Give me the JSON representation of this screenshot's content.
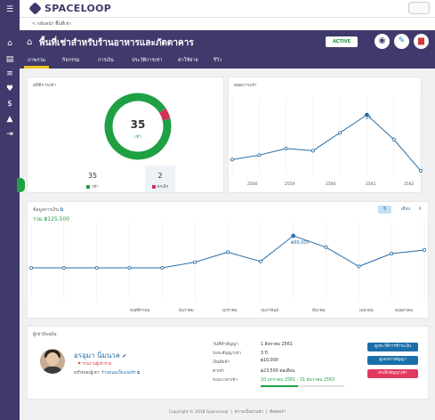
{
  "app": {
    "logo_text": "SPACELOOP"
  },
  "breadcrumb": {
    "back_label": "< กลับหน้า พื้นที่เช่า"
  },
  "header": {
    "title": "พื้นที่เช่าสำหรับร้านอาหารและภัตตาคาร",
    "status": "ACTIVE",
    "icons": {
      "title": "shop-icon",
      "view": "eye-icon",
      "edit": "pencil-icon",
      "delete": "trash-icon"
    },
    "colors": {
      "brand": "#3f3a6b",
      "accent_underline": "#f0c419",
      "edit": "#2a7fd4",
      "delete": "#d23a3a"
    }
  },
  "tabs": [
    {
      "label": "ภาพรวม",
      "active": true
    },
    {
      "label": "กิจกรรม",
      "active": false
    },
    {
      "label": "การเงิน",
      "active": false
    },
    {
      "label": "ประวัติการเช่า",
      "active": false
    },
    {
      "label": "ค่าใช้จ่าย",
      "active": false
    },
    {
      "label": "รีวิว",
      "active": false
    }
  ],
  "rental_stats": {
    "title": "สถิติการเช่า",
    "center_value": "35",
    "center_label": "เช่า",
    "rented": {
      "value": "35",
      "label": "เช่า",
      "color": "#1fa043"
    },
    "cancelled": {
      "value": "2",
      "label": "ยกเลิก",
      "color": "#d2335c"
    }
  },
  "rental_count": {
    "title": "ยอดการเช่า",
    "highlight_label": "27"
  },
  "finance": {
    "title": "ข้อมูลการเงิน",
    "total": "รวม ฿125,500",
    "toggle_year": "ปี",
    "toggle_month": "เดือน",
    "toggle_value": "0",
    "highlight_label": "฿90,000"
  },
  "tenant": {
    "title": "ผู้เช่าปัจจุบัน",
    "name": "อรอุมา นิ่มนวล",
    "report_link": "รายงานผู้เช่าราย",
    "business_label": "ธุรกิจของผู้เช่า:",
    "business_value": "ร้านขนมเบื้องเบอร์ร",
    "info": [
      {
        "key": "วันที่ทำสัญญา",
        "value": "1 สิงหาคม 2561"
      },
      {
        "key": "ระยะสัญญาเช่า",
        "value": "3 ปี"
      },
      {
        "key": "เงินมัดจำ",
        "value": "฿10,000"
      },
      {
        "key": "ค่าเช่า",
        "value": "฿23,500 ต่อเดือน"
      },
      {
        "key": "ระยะเวลาเช่า",
        "value": "10 มกราคม 2561 - 31 ธันวาคม 2563"
      }
    ],
    "lease_progress": 0.45,
    "buttons": [
      {
        "label": "ดูประวัติการชำระเงิน",
        "color": "#1b6fa8"
      },
      {
        "label": "ดูเอกสารสัญญา",
        "color": "#1b6fa8"
      },
      {
        "label": "ยกเลิกสัญญาเช่า",
        "color": "#e23a5e"
      }
    ]
  },
  "footer": {
    "copyright": "Copyright © 2018 SpaceLoop",
    "privacy": "ความเป็นส่วนตัว",
    "contact": "ติดต่อเรา"
  },
  "chart_data": [
    {
      "type": "pie",
      "categories": [
        "เช่า",
        "ยกเลิก"
      ],
      "values": [
        35,
        2
      ],
      "title": "สถิติการเช่า"
    },
    {
      "type": "line",
      "title": "ยอดการเช่า",
      "x": [
        "2560",
        "2559",
        "2560",
        "2561",
        "2562"
      ],
      "values": [
        7,
        9,
        12,
        11,
        19,
        27,
        16,
        2
      ],
      "value_units": "rentals",
      "ylim": [
        0,
        35
      ],
      "grid": "vertical"
    },
    {
      "type": "line",
      "title": "ข้อมูลการเงิน",
      "x": [
        "พฤศจิกายน",
        "ธันวาคม",
        "มกราคม",
        "กุมภาพันธ์",
        "มีนาคม",
        "เมษายน",
        "พฤษภาคม"
      ],
      "values": [
        45000,
        45000,
        45000,
        45000,
        45000,
        53000,
        67000,
        54000,
        90000,
        74000,
        47000,
        65000,
        70000
      ],
      "highlight": {
        "index": 8,
        "label": "฿90,000"
      },
      "ylim": [
        0,
        110000
      ],
      "grid": "vertical"
    }
  ]
}
